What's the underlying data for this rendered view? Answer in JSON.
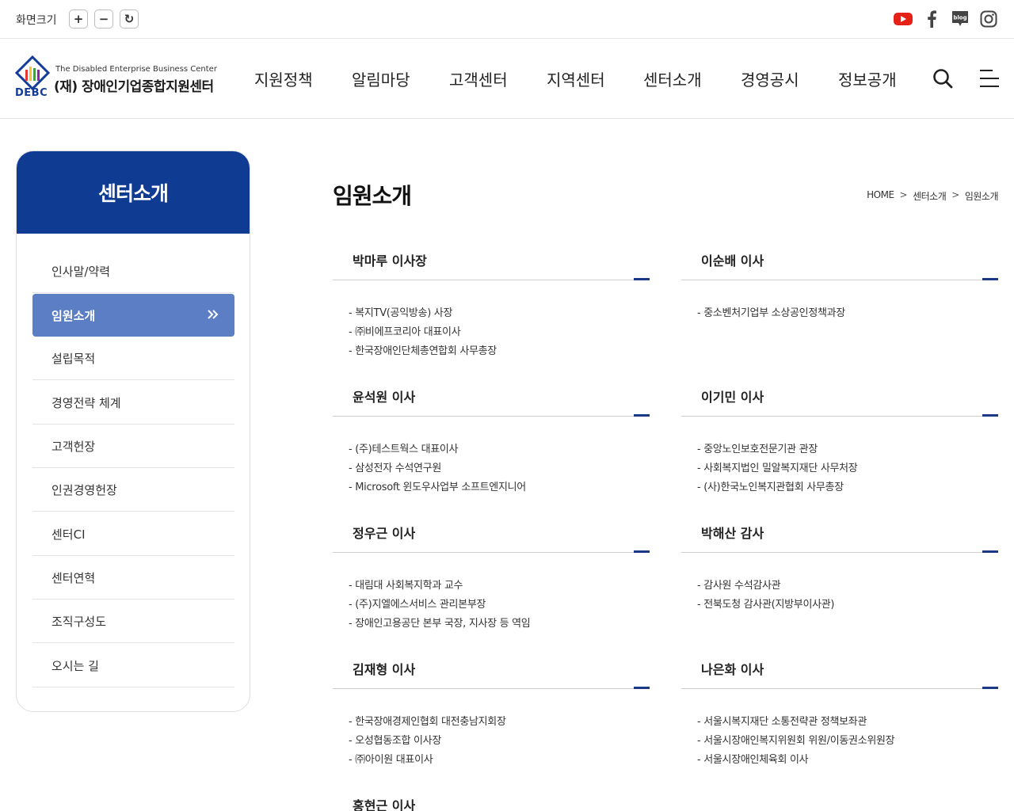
{
  "utilbar": {
    "zoom_label": "화면크기",
    "zoom_in": "+",
    "zoom_out": "−",
    "zoom_reset": "↻",
    "social": [
      "youtube-icon",
      "facebook-icon",
      "blog-icon",
      "instagram-icon"
    ]
  },
  "header": {
    "logo_en": "The Disabled Enterprise Business Center",
    "logo_ko": "(재) 장애인기업종합지원센터",
    "logo_abbr": "DEBC",
    "nav": [
      "지원정책",
      "알림마당",
      "고객센터",
      "지역센터",
      "센터소개",
      "경영공시",
      "정보공개"
    ]
  },
  "sidebar": {
    "title": "센터소개",
    "items": [
      "인사말/약력",
      "임원소개",
      "설립목적",
      "경영전략 체계",
      "고객헌장",
      "인권경영헌장",
      "센터CI",
      "센터연혁",
      "조직구성도",
      "오시는 길"
    ],
    "active_index": 1
  },
  "content": {
    "title": "임원소개",
    "breadcrumb": [
      "HOME",
      "센터소개",
      "임원소개"
    ],
    "breadcrumb_sep": ">",
    "executives": [
      {
        "name": "박마루 이사장",
        "roles": [
          "복지TV(공익방송) 사장",
          "㈜비에프코리아 대표이사",
          "한국장애인단체총연합회 사무총장"
        ]
      },
      {
        "name": "이순배 이사",
        "roles": [
          "중소벤처기업부 소상공인정책과장"
        ]
      },
      {
        "name": "윤석원 이사",
        "roles": [
          "(주)테스트웍스 대표이사",
          "삼성전자 수석연구원",
          "Microsoft 윈도우사업부 소프트엔지니어"
        ]
      },
      {
        "name": "이기민 이사",
        "roles": [
          "중앙노인보호전문기관 관장",
          "사회복지법인 밀알복지재단 사무처장",
          "(사)한국노인복지관협회 사무총장"
        ]
      },
      {
        "name": "정우근 이사",
        "roles": [
          "대림대 사회복지학과 교수",
          "(주)지엘에스서비스 관리본부장",
          "장애인고용공단 본부 국장, 지사장 등 역임"
        ]
      },
      {
        "name": "박해산 감사",
        "roles": [
          "감사원 수석감사관",
          "전북도청 감사관(지방부이사관)"
        ]
      },
      {
        "name": "김재형 이사",
        "roles": [
          "한국장애경제인협회 대전충남지회장",
          "오성협동조합 이사장",
          "㈜아이원 대표이사"
        ]
      },
      {
        "name": "나은화 이사",
        "roles": [
          "서울시복지재단 소통전략관 정책보좌관",
          "서울시장애인복지위원회 위원/이동권소위원장",
          "서울시장애인체육회 이사"
        ]
      },
      {
        "name": "홍현근 이사",
        "roles": []
      }
    ]
  }
}
